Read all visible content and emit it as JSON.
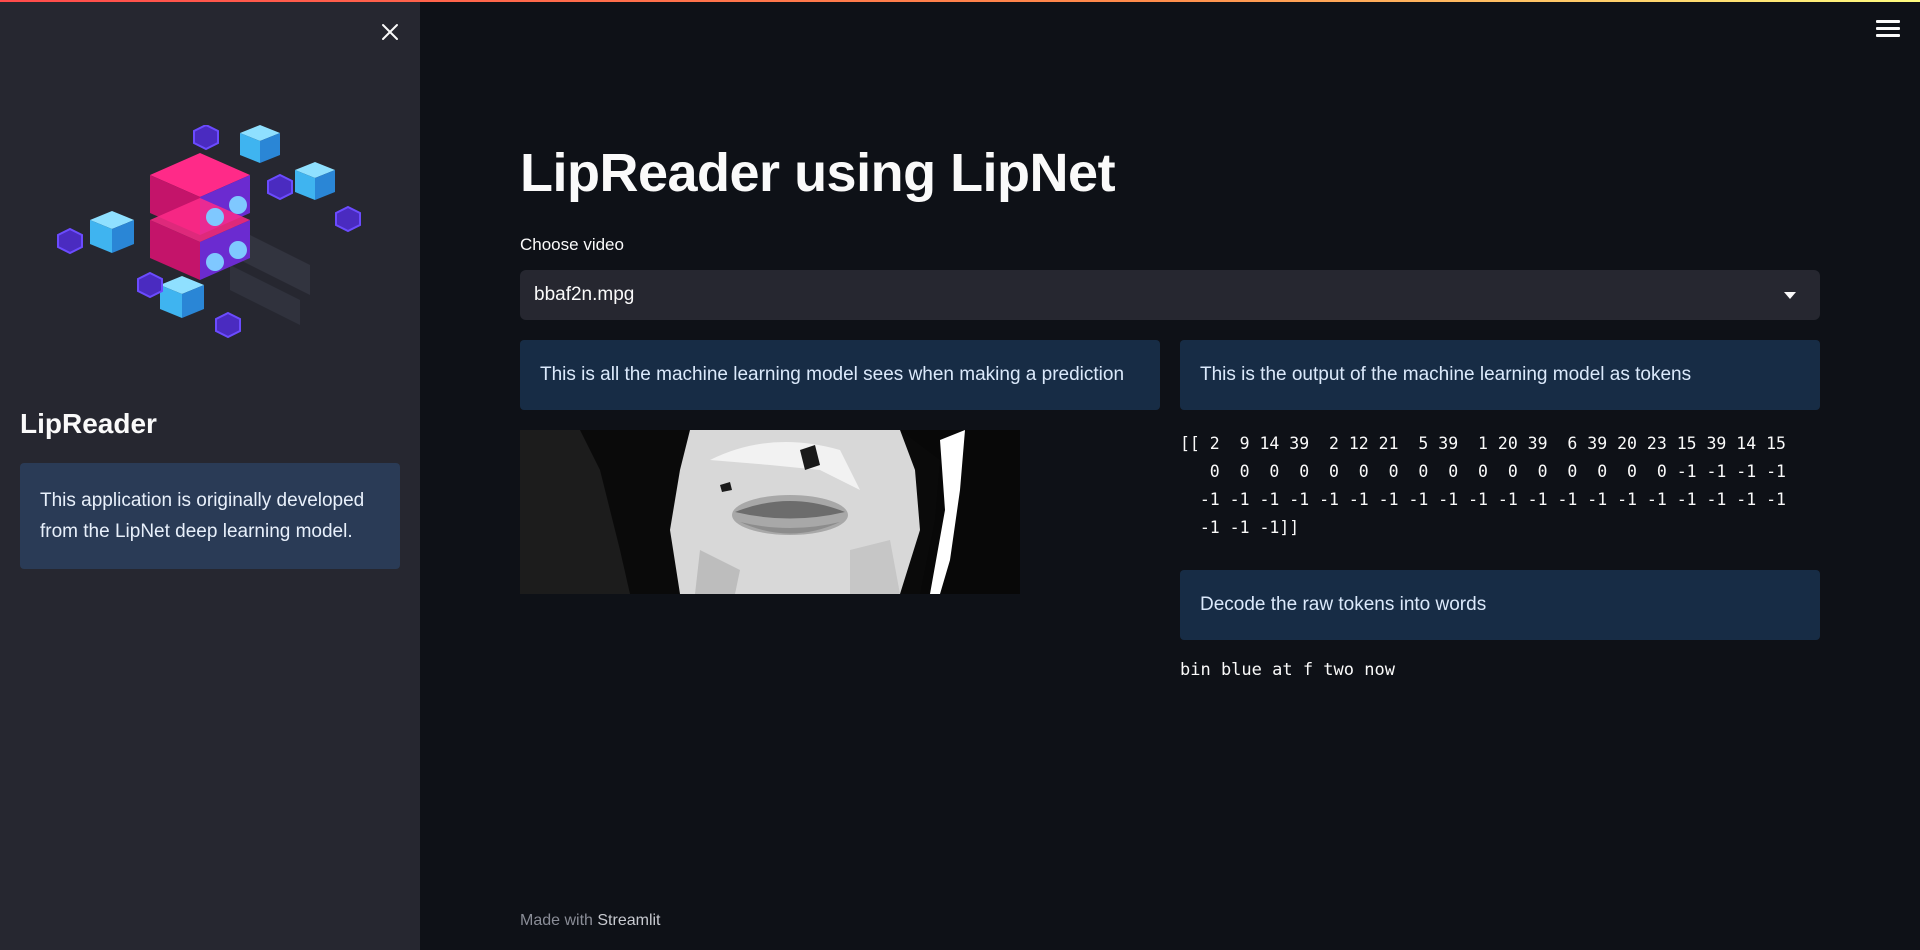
{
  "sidebar": {
    "close_icon": "close-icon",
    "logo_icon": "server-cubes-illustration",
    "title": "LipReader",
    "info": "This application is originally developed from the LipNet deep learning model."
  },
  "header": {
    "menu_icon": "hamburger-menu-icon"
  },
  "main": {
    "title": "LipReader using LipNet",
    "select_label": "Choose video",
    "select_value": "bbaf2n.mpg",
    "left_info": "This is all the machine learning model sees when making a prediction",
    "right_info": "This is the output of the machine learning model as tokens",
    "tokens": "[[ 2  9 14 39  2 12 21  5 39  1 20 39  6 39 20 23 15 39 14 15\n   0  0  0  0  0  0  0  0  0  0  0  0  0  0  0  0 -1 -1 -1 -1\n  -1 -1 -1 -1 -1 -1 -1 -1 -1 -1 -1 -1 -1 -1 -1 -1 -1 -1 -1 -1\n  -1 -1 -1]]",
    "decode_info": "Decode the raw tokens into words",
    "decoded_text": "bin blue at f two now"
  },
  "footer": {
    "made_with": "Made with ",
    "brand": "Streamlit"
  },
  "colors": {
    "background": "#0e1117",
    "sidebar": "#262730",
    "info_box": "#172c45",
    "sidebar_info": "#2a3b56"
  }
}
